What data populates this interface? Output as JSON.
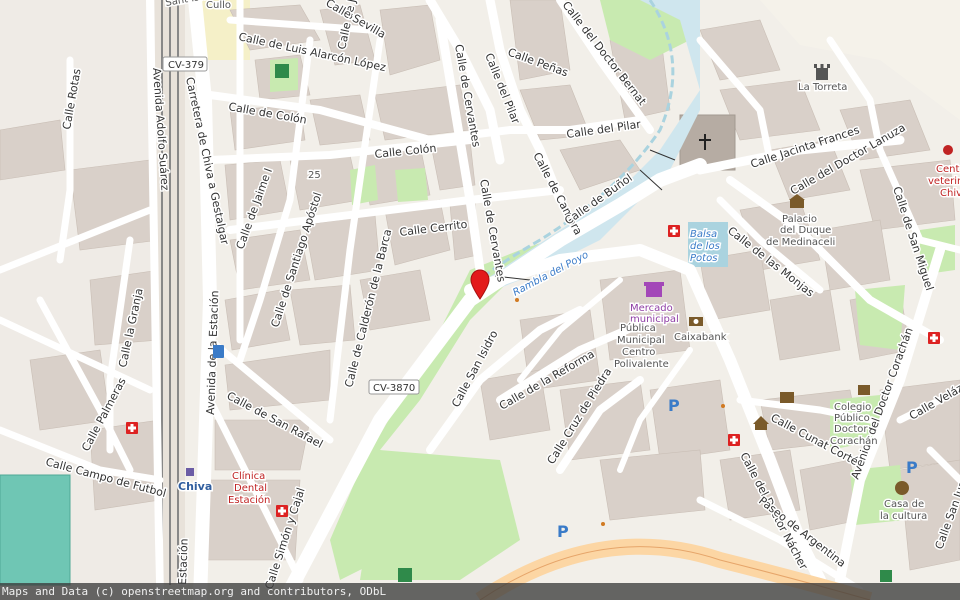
{
  "map": {
    "streets": [
      "Calle de Luis Alarcón López",
      "Calle de Colón",
      "Calle Colón",
      "Calle de Jaime I",
      "Calle de Santiago Apóstol",
      "Calle de Calderón de la Barca",
      "Calle Cerrito",
      "Calle de Cervantes",
      "Calle del Pilar",
      "Calle Peñas",
      "Calle del Doctor Bernat",
      "Calle de Cambra",
      "Calle de Buñol",
      "Calle Jacinta Frances",
      "Calle del Doctor Lanuza",
      "Calle de las Monjas",
      "Calle de San Miguel",
      "Calle San Isidro",
      "Calle de la Reforma",
      "Calle Cruz de Piedra",
      "Calle del Doctor Nácher",
      "Paseo de Argentina",
      "Calle Cunat Cortés",
      "Avenida del Doctor Corachán",
      "Calle Velázq",
      "Calle San Juan Ba",
      "Calle de San Rafael",
      "Avenida de la Estación",
      "Carretera de Chiva a Gestalgar",
      "Avenida Adolfo Suárez",
      "Calle Rotas",
      "Calle la Granja",
      "Calle Palmeras",
      "Calle Campo de Futbol",
      "Calle Simón y Cajal",
      "Estación",
      "Calle de Jaim",
      "Calle Sevilla",
      "Sant Isidre"
    ],
    "road_refs": [
      "CV-379",
      "CV-3870"
    ],
    "house_number": "25",
    "pois": {
      "torreta": "La Torreta",
      "palacio": [
        "Palacio",
        "del Duque",
        "de Medinaceli"
      ],
      "balsa": [
        "Balsa",
        "de los",
        "Potos"
      ],
      "mercado": [
        "Mercado",
        "municipal"
      ],
      "publica": [
        "Pública",
        "Municipal",
        "Centro",
        "Polivalente"
      ],
      "caixabank": "Caixabank",
      "rambla": "Rambla del Poyo",
      "colegio": [
        "Colegio",
        "Público",
        "Doctor",
        "Corachán"
      ],
      "casa_cultura": [
        "Casa de",
        "la cultura"
      ],
      "clinica": [
        "Clínica",
        "Dental",
        "Estación"
      ],
      "vet": [
        "Cent",
        "veterin",
        "Chiv"
      ],
      "chiva_station": "Chiva",
      "cullo": "Cullo"
    },
    "parking_symbol": "P",
    "pin_label": "selected-location",
    "colors": {
      "background": "#f2efe9",
      "building": "#d9d0c9",
      "park": "#c8eab0",
      "river": "#aad3df",
      "pitch": "#6fc6b4",
      "pin": "#e31b1b",
      "road_orange": "#fcd6a4"
    }
  },
  "attribution": "Maps and Data (c) openstreetmap.org and contributors, ODbL"
}
